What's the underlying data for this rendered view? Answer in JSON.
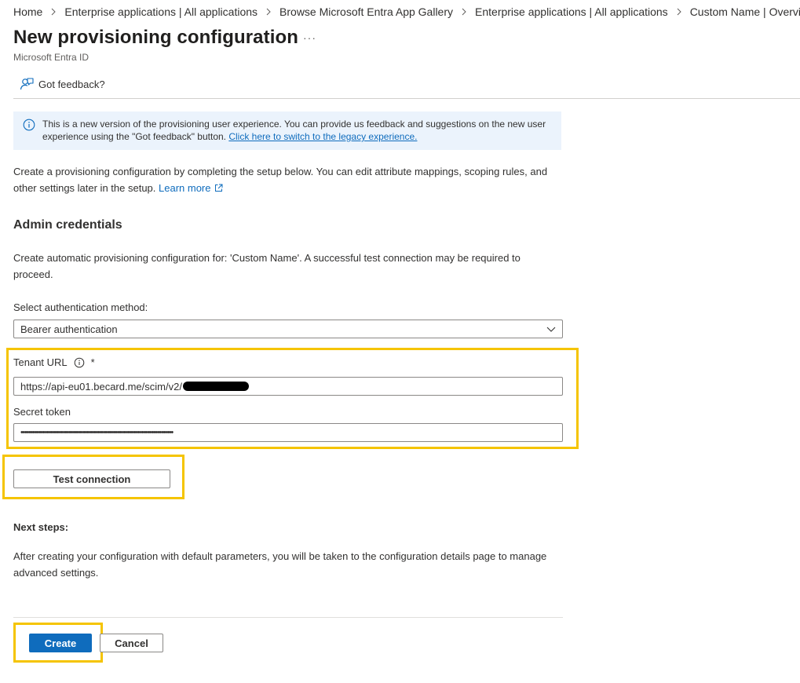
{
  "breadcrumb": [
    {
      "label": "Home"
    },
    {
      "label": "Enterprise applications | All applications"
    },
    {
      "label": "Browse Microsoft Entra App Gallery"
    },
    {
      "label": "Enterprise applications | All applications"
    },
    {
      "label": "Custom Name | Overview"
    }
  ],
  "header": {
    "title": "New provisioning configuration",
    "more": "···",
    "subtitle": "Microsoft Entra ID"
  },
  "toolbar": {
    "feedback_label": "Got feedback?",
    "feedback_icon": "feedback-person-icon"
  },
  "info_banner": {
    "text": "This is a new version of the provisioning user experience. You can provide us feedback and suggestions on the new user experience using the \"Got feedback\" button. ",
    "link": "Click here to switch to the legacy experience.",
    "icon": "info-icon"
  },
  "intro": {
    "text": "Create a provisioning configuration by completing the setup below. You can edit attribute mappings, scoping rules, and other settings later in the setup. ",
    "learn_more": "Learn more",
    "link_icon": "external-link-icon"
  },
  "admin_credentials": {
    "heading": "Admin credentials",
    "description": "Create automatic provisioning configuration for: 'Custom Name'. A successful test connection may be required to proceed.",
    "auth_method_label": "Select authentication method:",
    "auth_method_value": "Bearer authentication",
    "tenant_url_label": "Tenant URL",
    "required_mark": "*",
    "tenant_url_value": "https://api-eu01.becard.me/scim/v2/",
    "secret_token_label": "Secret token",
    "secret_token_value": "••••••••••••••••••••••••••••••••••••••••••••••••••••••••••••••••••••••••••••",
    "test_connection_label": "Test connection"
  },
  "next_steps": {
    "heading": "Next steps:",
    "description": "After creating your configuration with default parameters, you will be taken to the configuration details page to manage advanced settings."
  },
  "footer": {
    "create_label": "Create",
    "cancel_label": "Cancel"
  },
  "colors": {
    "accent": "#0f6cbd",
    "highlight": "#f5c400",
    "info_background": "#ebf3fc",
    "text": "#323130"
  }
}
